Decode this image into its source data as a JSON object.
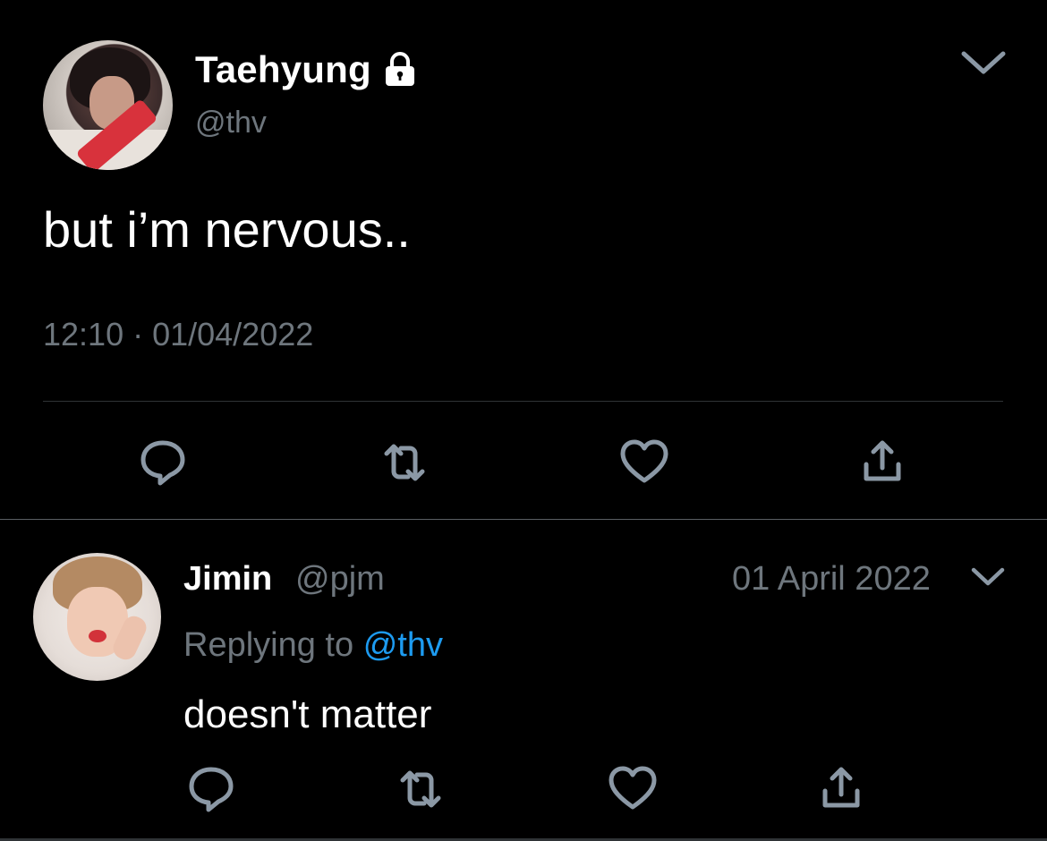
{
  "main_tweet": {
    "author_name": "Taehyung",
    "author_handle": "@thv",
    "protected_icon": "lock-icon",
    "menu_icon": "chevron-down-icon",
    "text": "but i’m nervous..",
    "timestamp": "12:10 · 01/04/2022",
    "actions": [
      {
        "name": "reply",
        "icon": "reply-icon"
      },
      {
        "name": "retweet",
        "icon": "retweet-icon"
      },
      {
        "name": "like",
        "icon": "heart-icon"
      },
      {
        "name": "share",
        "icon": "share-icon"
      }
    ]
  },
  "reply_tweet": {
    "author_name": "Jimin",
    "author_handle": "@pjm",
    "date": "01 April 2022",
    "menu_icon": "chevron-down-icon",
    "replying_label": "Replying to",
    "replying_handle": "@thv",
    "text": "doesn't matter",
    "actions": [
      {
        "name": "reply",
        "icon": "reply-icon"
      },
      {
        "name": "retweet",
        "icon": "retweet-icon"
      },
      {
        "name": "like",
        "icon": "heart-icon"
      },
      {
        "name": "share",
        "icon": "share-icon"
      }
    ]
  },
  "colors": {
    "background": "#000000",
    "text": "#ffffff",
    "secondary_text": "#6e767d",
    "link": "#1d9bf0",
    "icon": "#8b98a5",
    "divider": "#2f3336"
  }
}
